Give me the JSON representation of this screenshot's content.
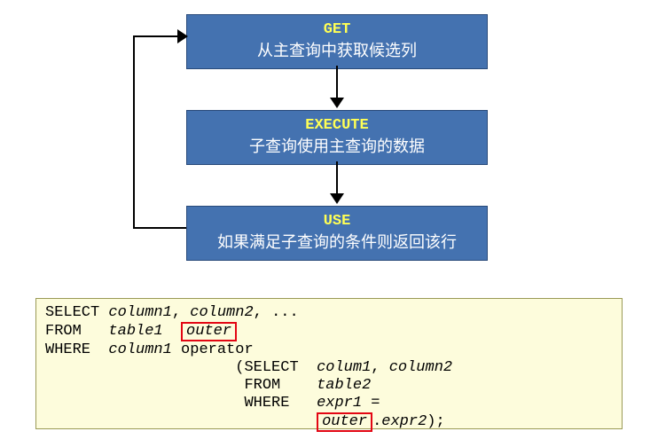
{
  "steps": [
    {
      "title": "GET",
      "desc": "从主查询中获取候选列"
    },
    {
      "title": "EXECUTE",
      "desc": "子查询使用主查询的数据"
    },
    {
      "title": "USE",
      "desc": "如果满足子查询的条件则返回该行"
    }
  ],
  "code": {
    "l1a": "SELECT ",
    "l1b": "column1",
    "l1c": ", ",
    "l1d": "column2",
    "l1e": ", ...",
    "l2a": "FROM   ",
    "l2b": "table1",
    "l2sp": "  ",
    "l2box": "outer",
    "l3a": "WHERE  ",
    "l3b": "column1",
    "l3c": " operator",
    "l4pad": "                     ",
    "l4a": "(SELECT  ",
    "l4b": "colum1",
    "l4c": ", ",
    "l4d": "column2",
    "l5pad": "                      ",
    "l5a": "FROM    ",
    "l5b": "table2",
    "l6pad": "                      ",
    "l6a": "WHERE   ",
    "l6b": "expr1",
    "l6c": " =",
    "l7pad": "                              ",
    "l7box": "outer",
    "l7a": ".",
    "l7b": "expr2",
    "l7c": ");"
  },
  "chart_data": {
    "type": "diagram",
    "kind": "flowchart",
    "nodes": [
      {
        "id": "n1",
        "title": "GET",
        "label": "从主查询中获取候选列"
      },
      {
        "id": "n2",
        "title": "EXECUTE",
        "label": "子查询使用主查询的数据"
      },
      {
        "id": "n3",
        "title": "USE",
        "label": "如果满足子查询的条件则返回该行"
      }
    ],
    "edges": [
      {
        "from": "n1",
        "to": "n2"
      },
      {
        "from": "n2",
        "to": "n3"
      },
      {
        "from": "n3",
        "to": "n1",
        "loop": true
      }
    ],
    "code_example": "SELECT column1, column2, ...\nFROM   table1  outer\nWHERE  column1 operator\n                     (SELECT  colum1, column2\n                      FROM    table2\n                      WHERE   expr1 =\n                              outer.expr2);",
    "highlights": [
      "outer",
      "outer"
    ]
  }
}
